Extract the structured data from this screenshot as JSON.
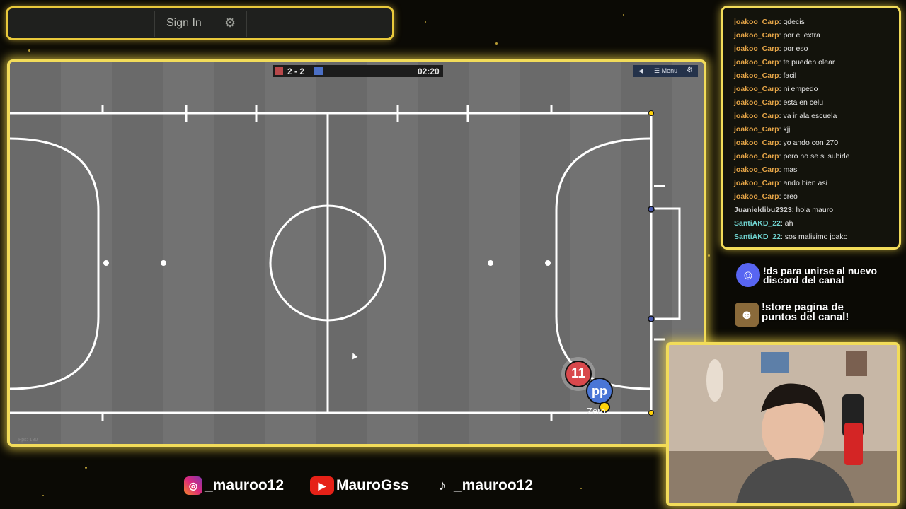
{
  "topbar": {
    "signin_label": "Sign In",
    "gear_icon": "gear-icon"
  },
  "game": {
    "score": "2 - 2",
    "timer": "02:20",
    "menu_label": "Menu",
    "volume_icon": "speaker-icon",
    "fps_text": "Fps: 180",
    "team_colors": {
      "red": "#b8484a",
      "blue": "#4b6fc5"
    },
    "players": [
      {
        "label": "11",
        "team": "red"
      },
      {
        "label": "pp",
        "team": "blue",
        "name": "Zero"
      }
    ]
  },
  "chat": {
    "messages": [
      {
        "user": "joakoo_Carp",
        "color": "#e3a346",
        "text": ": qdecis"
      },
      {
        "user": "joakoo_Carp",
        "color": "#e3a346",
        "text": ": por el extra"
      },
      {
        "user": "joakoo_Carp",
        "color": "#e3a346",
        "text": ": por eso"
      },
      {
        "user": "joakoo_Carp",
        "color": "#e3a346",
        "text": ": te pueden olear"
      },
      {
        "user": "joakoo_Carp",
        "color": "#e3a346",
        "text": ": facil"
      },
      {
        "user": "joakoo_Carp",
        "color": "#e3a346",
        "text": ": ni empedo"
      },
      {
        "user": "joakoo_Carp",
        "color": "#e3a346",
        "text": ": esta en celu"
      },
      {
        "user": "joakoo_Carp",
        "color": "#e3a346",
        "text": ": va ir ala escuela"
      },
      {
        "user": "joakoo_Carp",
        "color": "#e3a346",
        "text": ": kjj"
      },
      {
        "user": "joakoo_Carp",
        "color": "#e3a346",
        "text": ": yo ando con 270"
      },
      {
        "user": "joakoo_Carp",
        "color": "#e3a346",
        "text": ": pero no se si subirle"
      },
      {
        "user": "joakoo_Carp",
        "color": "#e3a346",
        "text": ": mas"
      },
      {
        "user": "joakoo_Carp",
        "color": "#e3a346",
        "text": ": ando bien asi"
      },
      {
        "user": "joakoo_Carp",
        "color": "#e3a346",
        "text": ": creo"
      },
      {
        "user": "Juanieldibu2323",
        "color": "#c9c9c9",
        "text": ": hola mauro"
      },
      {
        "user": "SantiAKD_22",
        "color": "#6fd3cf",
        "text": ": ah"
      },
      {
        "user": "SantiAKD_22",
        "color": "#6fd3cf",
        "text": ": sos malisimo joako"
      }
    ]
  },
  "promos": {
    "discord_line1": "!ds para unirse al nuevo",
    "discord_line2": "discord del canal",
    "store_line1": "!store pagina de",
    "store_line2": "puntos del canal!"
  },
  "socials": {
    "instagram": "_mauroo12",
    "youtube": "MauroGss",
    "tiktok": "_mauroo12"
  }
}
